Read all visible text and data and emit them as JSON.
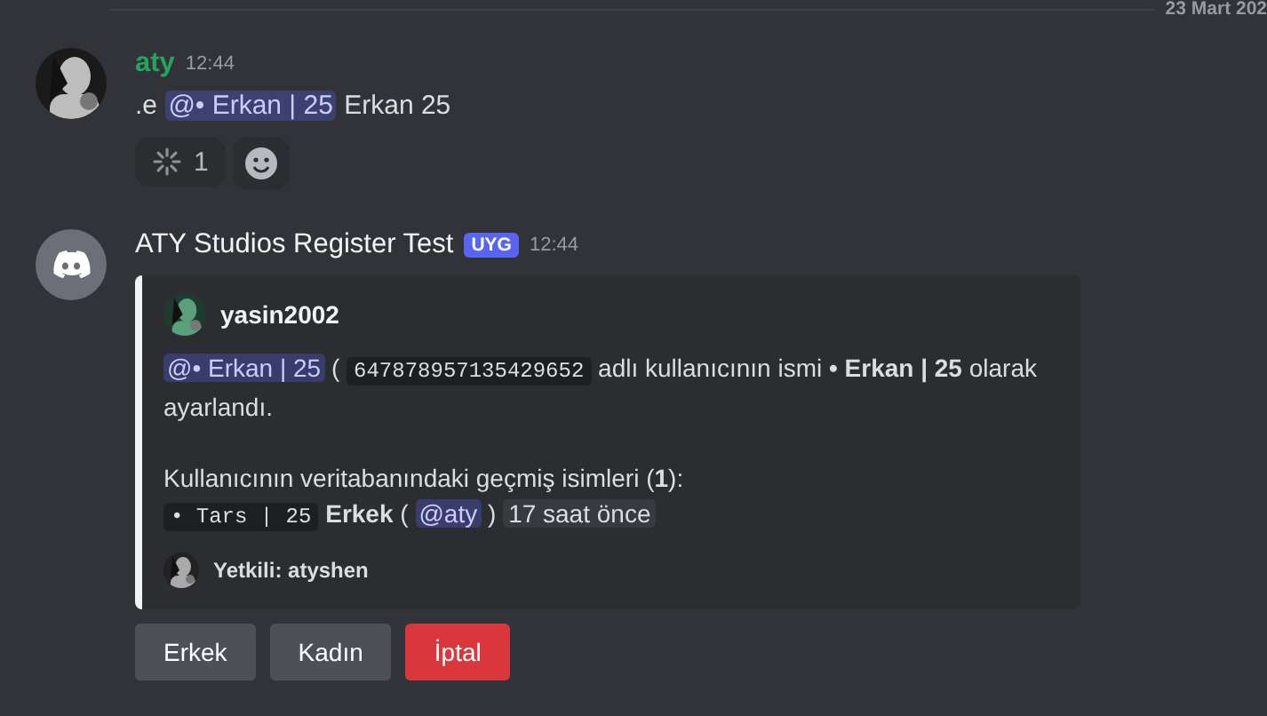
{
  "date_divider": "23 Mart 202",
  "messages": [
    {
      "kind": "user",
      "author": "aty",
      "time": "12:44",
      "content": [
        {
          "kind": "text",
          "text": ".e"
        },
        {
          "kind": "mention",
          "text": "@• Erkan | 25"
        },
        {
          "kind": "text",
          "text": "Erkan 25"
        }
      ],
      "reactions": [
        {
          "count": "1",
          "selected": false
        }
      ]
    },
    {
      "kind": "bot",
      "author": "ATY Studios Register Test",
      "tag": "UYG",
      "time": "12:44",
      "embed": {
        "author": "yasin2002",
        "paragraphs": [
          [
            {
              "kind": "mention",
              "text": "@• Erkan | 25"
            },
            {
              "kind": "text",
              "text": "("
            },
            {
              "kind": "code",
              "text": "647878957135429652"
            },
            {
              "kind": "text",
              "text": "adlı kullanıcının ismi"
            },
            {
              "kind": "bold",
              "text": "• Erkan | 25"
            },
            {
              "kind": "text",
              "text": "olarak ayarlandı."
            }
          ],
          [
            {
              "kind": "text",
              "text": "Kullanıcının veritabanındaki geçmiş isimleri (**1**):"
            }
          ],
          [
            {
              "kind": "code",
              "text": "• Tars | 25"
            },
            {
              "kind": "bold",
              "text": "Erkek"
            },
            {
              "kind": "text",
              "text": "("
            },
            {
              "kind": "mention",
              "text": "@aty"
            },
            {
              "kind": "text",
              "text": ")"
            },
            {
              "kind": "time",
              "text": "17 saat önce"
            }
          ]
        ],
        "footer": "Yetkili: atyshen"
      },
      "buttons": [
        {
          "label": "Erkek",
          "kind": "secondary"
        },
        {
          "label": "Kadın",
          "kind": "secondary"
        },
        {
          "label": "İptal",
          "kind": "danger"
        }
      ]
    }
  ]
}
